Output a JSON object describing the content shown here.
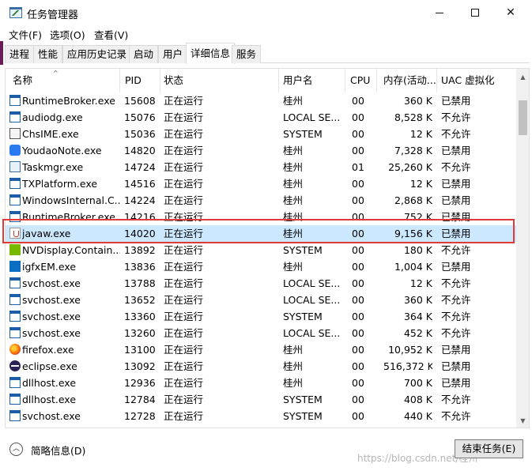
{
  "window": {
    "title": "任务管理器",
    "minimize_icon": "minimize-icon",
    "maximize_icon": "maximize-icon",
    "close_symbol": "✕"
  },
  "menu": [
    "文件(F)",
    "选项(O)",
    "查看(V)"
  ],
  "tabs": [
    "进程",
    "性能",
    "应用历史记录",
    "启动",
    "用户",
    "详细信息",
    "服务"
  ],
  "active_tab": "详细信息",
  "columns": {
    "name": "名称",
    "pid": "PID",
    "status": "状态",
    "user": "用户名",
    "cpu": "CPU",
    "memory": "内存(活动...",
    "uac": "UAC 虚拟化"
  },
  "sort_indicator": "^",
  "rows": [
    {
      "icon": "window-app-icon",
      "name": "RuntimeBroker.exe",
      "pid": "15608",
      "status": "正在运行",
      "user": "桂州",
      "cpu": "00",
      "memory": "360 K",
      "uac": "已禁用"
    },
    {
      "icon": "window-app-icon",
      "name": "audiodg.exe",
      "pid": "15076",
      "status": "正在运行",
      "user": "LOCAL SE...",
      "cpu": "00",
      "memory": "8,528 K",
      "uac": "不允许"
    },
    {
      "icon": "ime-icon",
      "name": "ChsIME.exe",
      "pid": "15036",
      "status": "正在运行",
      "user": "SYSTEM",
      "cpu": "00",
      "memory": "12 K",
      "uac": "不允许"
    },
    {
      "icon": "youdao-icon",
      "name": "YoudaoNote.exe",
      "pid": "14820",
      "status": "正在运行",
      "user": "桂州",
      "cpu": "00",
      "memory": "7,328 K",
      "uac": "已禁用"
    },
    {
      "icon": "taskmgr-icon",
      "name": "Taskmgr.exe",
      "pid": "14724",
      "status": "正在运行",
      "user": "桂州",
      "cpu": "01",
      "memory": "25,260 K",
      "uac": "不允许"
    },
    {
      "icon": "window-app-icon",
      "name": "TXPlatform.exe",
      "pid": "14516",
      "status": "正在运行",
      "user": "桂州",
      "cpu": "00",
      "memory": "12 K",
      "uac": "已禁用"
    },
    {
      "icon": "window-app-icon",
      "name": "WindowsInternal.C...",
      "pid": "14224",
      "status": "正在运行",
      "user": "桂州",
      "cpu": "00",
      "memory": "2,868 K",
      "uac": "已禁用"
    },
    {
      "icon": "window-app-icon",
      "name": "RuntimeBroker.exe",
      "pid": "14216",
      "status": "正在运行",
      "user": "桂州",
      "cpu": "00",
      "memory": "752 K",
      "uac": "已禁用"
    },
    {
      "icon": "java-icon",
      "name": "javaw.exe",
      "pid": "14020",
      "status": "正在运行",
      "user": "桂州",
      "cpu": "00",
      "memory": "9,156 K",
      "uac": "已禁用"
    },
    {
      "icon": "nvidia-icon",
      "name": "NVDisplay.Contain...",
      "pid": "13892",
      "status": "正在运行",
      "user": "SYSTEM",
      "cpu": "00",
      "memory": "180 K",
      "uac": "不允许"
    },
    {
      "icon": "intel-icon",
      "name": "igfxEM.exe",
      "pid": "13836",
      "status": "正在运行",
      "user": "桂州",
      "cpu": "00",
      "memory": "1,004 K",
      "uac": "已禁用"
    },
    {
      "icon": "window-app-icon",
      "name": "svchost.exe",
      "pid": "13788",
      "status": "正在运行",
      "user": "LOCAL SE...",
      "cpu": "00",
      "memory": "12 K",
      "uac": "不允许"
    },
    {
      "icon": "window-app-icon",
      "name": "svchost.exe",
      "pid": "13652",
      "status": "正在运行",
      "user": "LOCAL SE...",
      "cpu": "00",
      "memory": "360 K",
      "uac": "不允许"
    },
    {
      "icon": "window-app-icon",
      "name": "svchost.exe",
      "pid": "13360",
      "status": "正在运行",
      "user": "SYSTEM",
      "cpu": "00",
      "memory": "364 K",
      "uac": "不允许"
    },
    {
      "icon": "window-app-icon",
      "name": "svchost.exe",
      "pid": "13260",
      "status": "正在运行",
      "user": "LOCAL SE...",
      "cpu": "00",
      "memory": "452 K",
      "uac": "不允许"
    },
    {
      "icon": "firefox-icon",
      "name": "firefox.exe",
      "pid": "13100",
      "status": "正在运行",
      "user": "桂州",
      "cpu": "00",
      "memory": "10,952 K",
      "uac": "已禁用"
    },
    {
      "icon": "eclipse-icon",
      "name": "eclipse.exe",
      "pid": "13092",
      "status": "正在运行",
      "user": "桂州",
      "cpu": "00",
      "memory": "516,372 K",
      "uac": "已禁用"
    },
    {
      "icon": "window-app-icon",
      "name": "dllhost.exe",
      "pid": "12936",
      "status": "正在运行",
      "user": "桂州",
      "cpu": "00",
      "memory": "700 K",
      "uac": "已禁用"
    },
    {
      "icon": "window-app-icon",
      "name": "dllhost.exe",
      "pid": "12784",
      "status": "正在运行",
      "user": "SYSTEM",
      "cpu": "00",
      "memory": "408 K",
      "uac": "不允许"
    },
    {
      "icon": "window-app-icon",
      "name": "svchost.exe",
      "pid": "12728",
      "status": "正在运行",
      "user": "SYSTEM",
      "cpu": "00",
      "memory": "440 K",
      "uac": "不允许"
    }
  ],
  "selected_row_index": 8,
  "highlight_color": "#e03a3a",
  "selected_row_color": "#cce8ff",
  "footer": {
    "collapse_label": "简略信息(D)",
    "end_task_label": "结束任务(E)",
    "watermark": "https://blog.csdn.net/桂州"
  }
}
